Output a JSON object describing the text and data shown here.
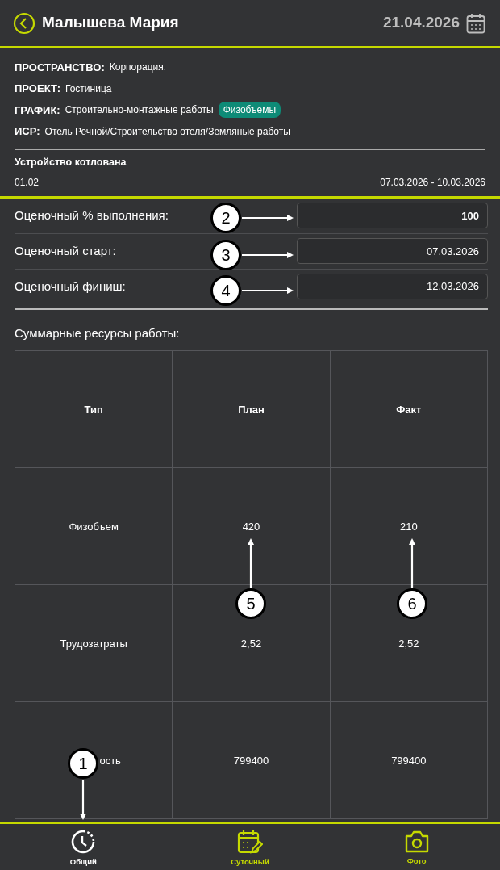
{
  "header": {
    "title": "Малышева Мария",
    "date": "21.04.2026"
  },
  "info": [
    {
      "label": "ПРОСТРАНСТВО:",
      "value": "Корпорация."
    },
    {
      "label": "ПРОЕКТ:",
      "value": "Гостиница"
    },
    {
      "label": "ГРАФИК:",
      "value": "Строительно-монтажные работы",
      "tag": "Физобъемы"
    },
    {
      "label": "ИСР:",
      "value": "Отель Речной/Строительство отеля/Земляные работы"
    }
  ],
  "task": {
    "name": "Устройство котлована",
    "code": "01.02",
    "period": "07.03.2026 - 10.03.2026"
  },
  "fields": [
    {
      "label": "Оценочный % выполнения:",
      "value": "100",
      "bold": true
    },
    {
      "label": "Оценочный старт:",
      "value": "07.03.2026",
      "bold": false
    },
    {
      "label": "Оценочный финиш:",
      "value": "12.03.2026",
      "bold": false
    }
  ],
  "resources": {
    "title": "Суммарные ресурсы работы:",
    "columns": [
      "Тип",
      "План",
      "Факт"
    ],
    "rows": [
      [
        "Физобъем",
        "420",
        "210"
      ],
      [
        "Трудозатраты",
        "2,52",
        "2,52"
      ],
      [
        "ость",
        "799400",
        "799400"
      ]
    ]
  },
  "bottom_nav": [
    {
      "label": "Общий",
      "selected": true
    },
    {
      "label": "Суточный",
      "selected": false
    },
    {
      "label": "Фото",
      "selected": false
    }
  ],
  "callouts": [
    "1",
    "2",
    "3",
    "4",
    "5",
    "6"
  ]
}
